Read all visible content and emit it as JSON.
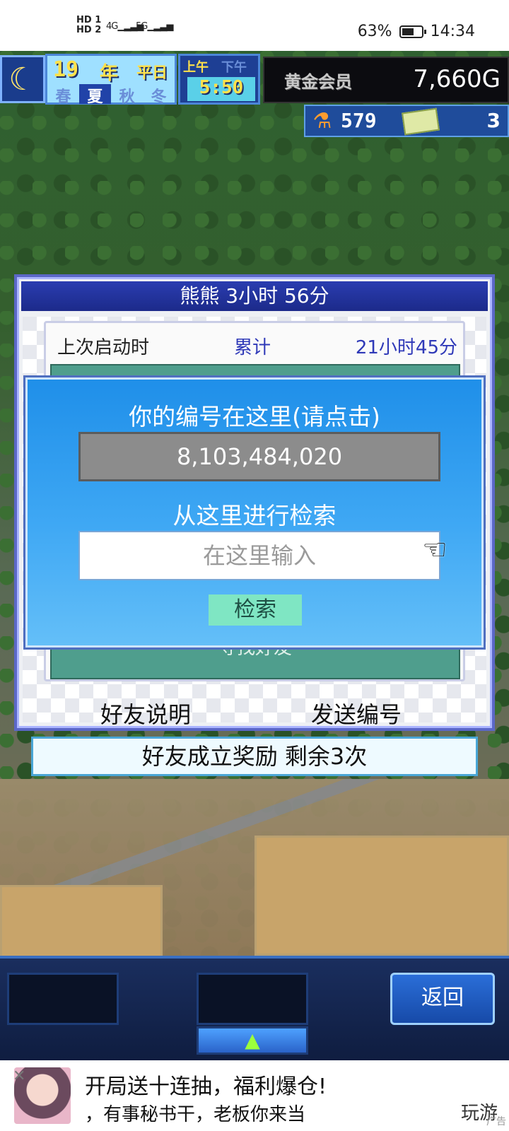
{
  "status_bar": {
    "hd1": "HD 1",
    "hd2": "HD 2",
    "net1": "4G",
    "net2": "5G",
    "battery_pct": "63%",
    "battery_fraction": 0.63,
    "time": "14:34"
  },
  "hud": {
    "moon_icon": "crescent-moon-icon",
    "year": "19",
    "year_label": "年",
    "weekday": "平日",
    "seasons": [
      "春",
      "夏",
      "秋",
      "冬"
    ],
    "active_season": "夏",
    "am": "上午",
    "pm": "下午",
    "clock": "5:50",
    "rank": "黄金会员",
    "money": "7,660G",
    "research_points": "579",
    "tickets": "3"
  },
  "panel": {
    "title": "熊熊  3小时 56分",
    "last_launch_label": "上次启动时",
    "total_label": "累计",
    "total_value": "21小时45分",
    "find_friend_label": "寻找好友",
    "help_label": "好友说明",
    "send_id_label": "发送编号"
  },
  "reward": {
    "text": "好友成立奖励  剩余3次"
  },
  "dialog": {
    "title": "你的编号在这里(请点击)",
    "player_id": "8,103,484,020",
    "search_label": "从这里进行检索",
    "search_placeholder": "在这里输入",
    "search_button": "检索"
  },
  "bottom": {
    "back_label": "返回",
    "expand_arrow": "▲"
  },
  "ad": {
    "headline": "开局送十连抽，福利爆仓!",
    "sub": "，有事秘书干，老板你来当",
    "brand": "玩游",
    "tag": "广告"
  }
}
